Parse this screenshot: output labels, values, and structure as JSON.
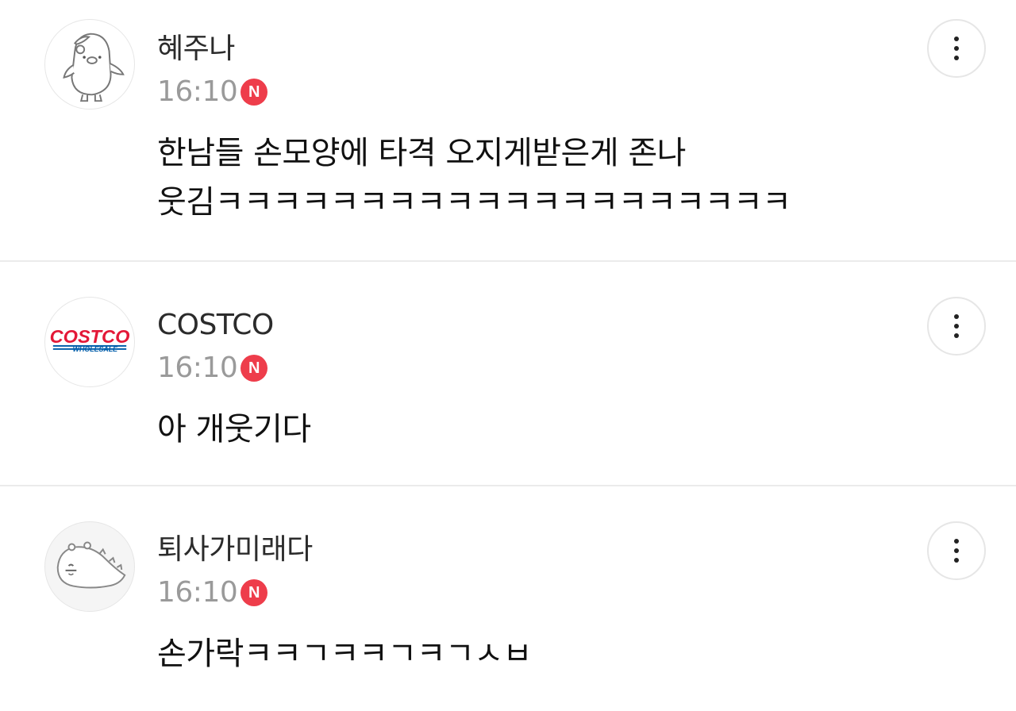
{
  "comments": [
    {
      "author": "혜주나",
      "time": "16:10",
      "badge": "N",
      "text": "한남들 손모양에 타격 오지게받은게 존나\n웃김ㅋㅋㅋㅋㅋㅋㅋㅋㅋㅋㅋㅋㅋㅋㅋㅋㅋㅋㅋㅋ",
      "avatar_icon": "penguin-character-icon"
    },
    {
      "author": "COSTCO",
      "time": "16:10",
      "badge": "N",
      "text": "아 개웃기다",
      "avatar_icon": "costco-logo-icon",
      "avatar_logo_top": "COSTCO",
      "avatar_logo_bottom": "WHOLESALE"
    },
    {
      "author": "퇴사가미래다",
      "time": "16:10",
      "badge": "N",
      "text": "손가락ㅋㅋㄱㅋㅋㄱㅋㄱㅅㅂ",
      "avatar_icon": "dinosaur-character-icon"
    }
  ],
  "colors": {
    "badge": "#ee3d4b",
    "time": "#9a9a9a",
    "divider": "#ebebeb",
    "costco_red": "#e31837",
    "costco_blue": "#005daa"
  }
}
